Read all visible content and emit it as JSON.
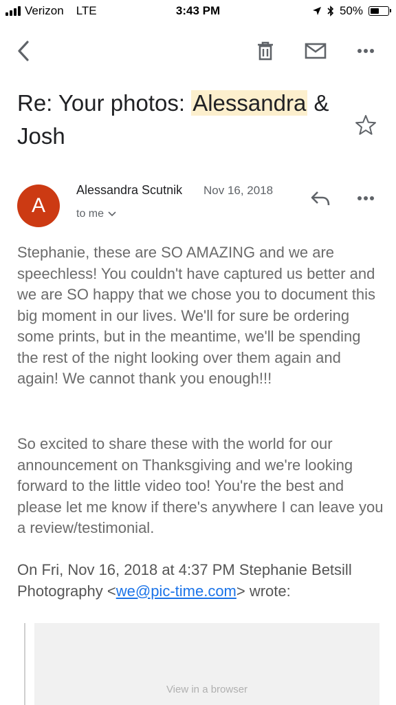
{
  "status_bar": {
    "carrier": "Verizon",
    "network": "LTE",
    "time": "3:43 PM",
    "battery": "50%",
    "battery_level": 0.5
  },
  "toolbar": {
    "back_icon": "back-arrow-icon",
    "delete_icon": "trash-icon",
    "mark_unread_icon": "envelope-icon",
    "more_icon": "more-dots-icon"
  },
  "email": {
    "subject_prefix": "Re: Your photos: ",
    "subject_highlight": "Alessandra",
    "subject_suffix": " & Josh",
    "sender_name": "Alessandra Scutnik",
    "sender_initial": "A",
    "avatar_color": "#cc3a13",
    "date": "Nov 16, 2018",
    "recipient_label": "to me",
    "body_paragraph_1": "Stephanie, these are SO AMAZING and we are speechless! You couldn't have captured us better and we are SO happy that we chose you to document this big moment in our lives. We'll for sure be ordering some prints, but in the meantime, we'll be spending the rest of the night looking over them again and again! We cannot thank you enough!!!",
    "body_paragraph_2": "So excited to share these with the world for our announcement on Thanksgiving and we're looking forward to the little video too! You're the best and please let me know if there's anywhere I can leave you a review/testimonial.",
    "quote_intro": "On Fri, Nov 16, 2018 at 4:37 PM Stephanie Betsill Photography <",
    "quote_email": "we@pic-time.com",
    "quote_outro": "> wrote:",
    "quoted_view_link": "View in a browser"
  },
  "colors": {
    "highlight": "#fcefcd",
    "link": "#1a73e8",
    "body_text": "#6b6b6b"
  }
}
